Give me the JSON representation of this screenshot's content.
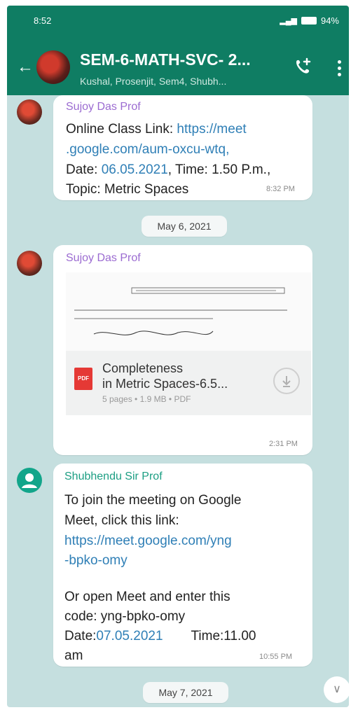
{
  "status_bar": {
    "time": "8:52",
    "battery": "94%"
  },
  "header": {
    "title": "SEM-6-MATH-SVC- 2...",
    "subtitle": "Kushal, Prosenjit, Sem4, Shubh..."
  },
  "messages": [
    {
      "sender": "Sujoy Das Prof",
      "lines": [
        "Online Class Link: ",
        ".google.com/aum-oxcu-wtq,",
        "Date: ",
        ", Time: 1.50 P.m.,",
        "Topic: Metric Spaces"
      ],
      "link1": "https://meet",
      "date_value": "06.05.2021",
      "time": "8:32 PM"
    },
    {
      "date_divider": "May 6, 2021"
    },
    {
      "sender": "Sujoy Das Prof",
      "doc_name_line1": "Completeness",
      "doc_name_line2": "in Metric Spaces-6.5...",
      "doc_meta": "5 pages • 1.9 MB • PDF",
      "pdf_label": "PDF",
      "time": "2:31 PM"
    },
    {
      "sender": "Shubhendu Sir Prof",
      "line1": "To join the meeting on Google",
      "line2": "Meet, click this link:",
      "link_line1": "https://meet.google.com/yng",
      "link_line2": "-bpko-omy",
      "line3": "Or open Meet and enter this",
      "line4": "code: yng-bpko-omy",
      "date_label": "Date:",
      "date_value": "07.05.2021",
      "time_label": "Time:11.00",
      "am": "am",
      "time": "10:55 PM"
    },
    {
      "date_divider": "May 7, 2021"
    }
  ],
  "colors": {
    "header": "#0f7d63",
    "chat_bg": "#c5dfdf",
    "link": "#2f7fb6",
    "sender1": "#9b6bd1",
    "sender2": "#1c9e83"
  }
}
